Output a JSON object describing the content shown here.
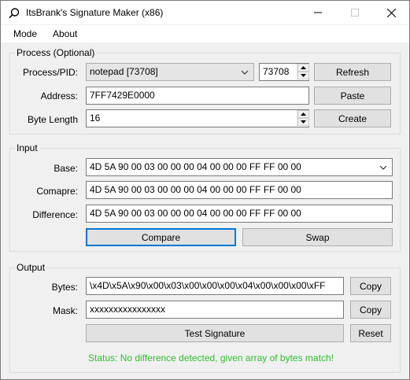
{
  "window": {
    "title": "ItsBrank's Signature Maker (x86)"
  },
  "menu": {
    "items": [
      "Mode",
      "About"
    ]
  },
  "process": {
    "group_title": "Process (Optional)",
    "pid_label": "Process/PID:",
    "process_selected": "notepad [73708]",
    "pid_value": "73708",
    "refresh_label": "Refresh",
    "address_label": "Address:",
    "address_value": "7FF7429E0000",
    "paste_label": "Paste",
    "length_label": "Byte Length",
    "length_value": "16",
    "create_label": "Create"
  },
  "input": {
    "group_title": "Input",
    "base_label": "Base:",
    "base_value": "4D 5A 90 00 03 00 00 00 04 00 00 00 FF FF 00 00",
    "compare_label": "Comapre:",
    "compare_value": "4D 5A 90 00 03 00 00 00 04 00 00 00 FF FF 00 00",
    "difference_label": "Difference:",
    "difference_value": "4D 5A 90 00 03 00 00 00 04 00 00 00 FF FF 00 00",
    "compare_button": "Compare",
    "swap_button": "Swap"
  },
  "output": {
    "group_title": "Output",
    "bytes_label": "Bytes:",
    "bytes_value": "\\x4D\\x5A\\x90\\x00\\x03\\x00\\x00\\x00\\x04\\x00\\x00\\x00\\xFF",
    "copy_bytes_label": "Copy",
    "mask_label": "Mask:",
    "mask_value": "xxxxxxxxxxxxxxxx",
    "copy_mask_label": "Copy",
    "test_label": "Test Signature",
    "reset_label": "Reset",
    "status": "Status: No difference detected, given array of bytes match!"
  },
  "colors": {
    "status_green": "#2dbf2d",
    "focus_blue": "#0078d7"
  }
}
